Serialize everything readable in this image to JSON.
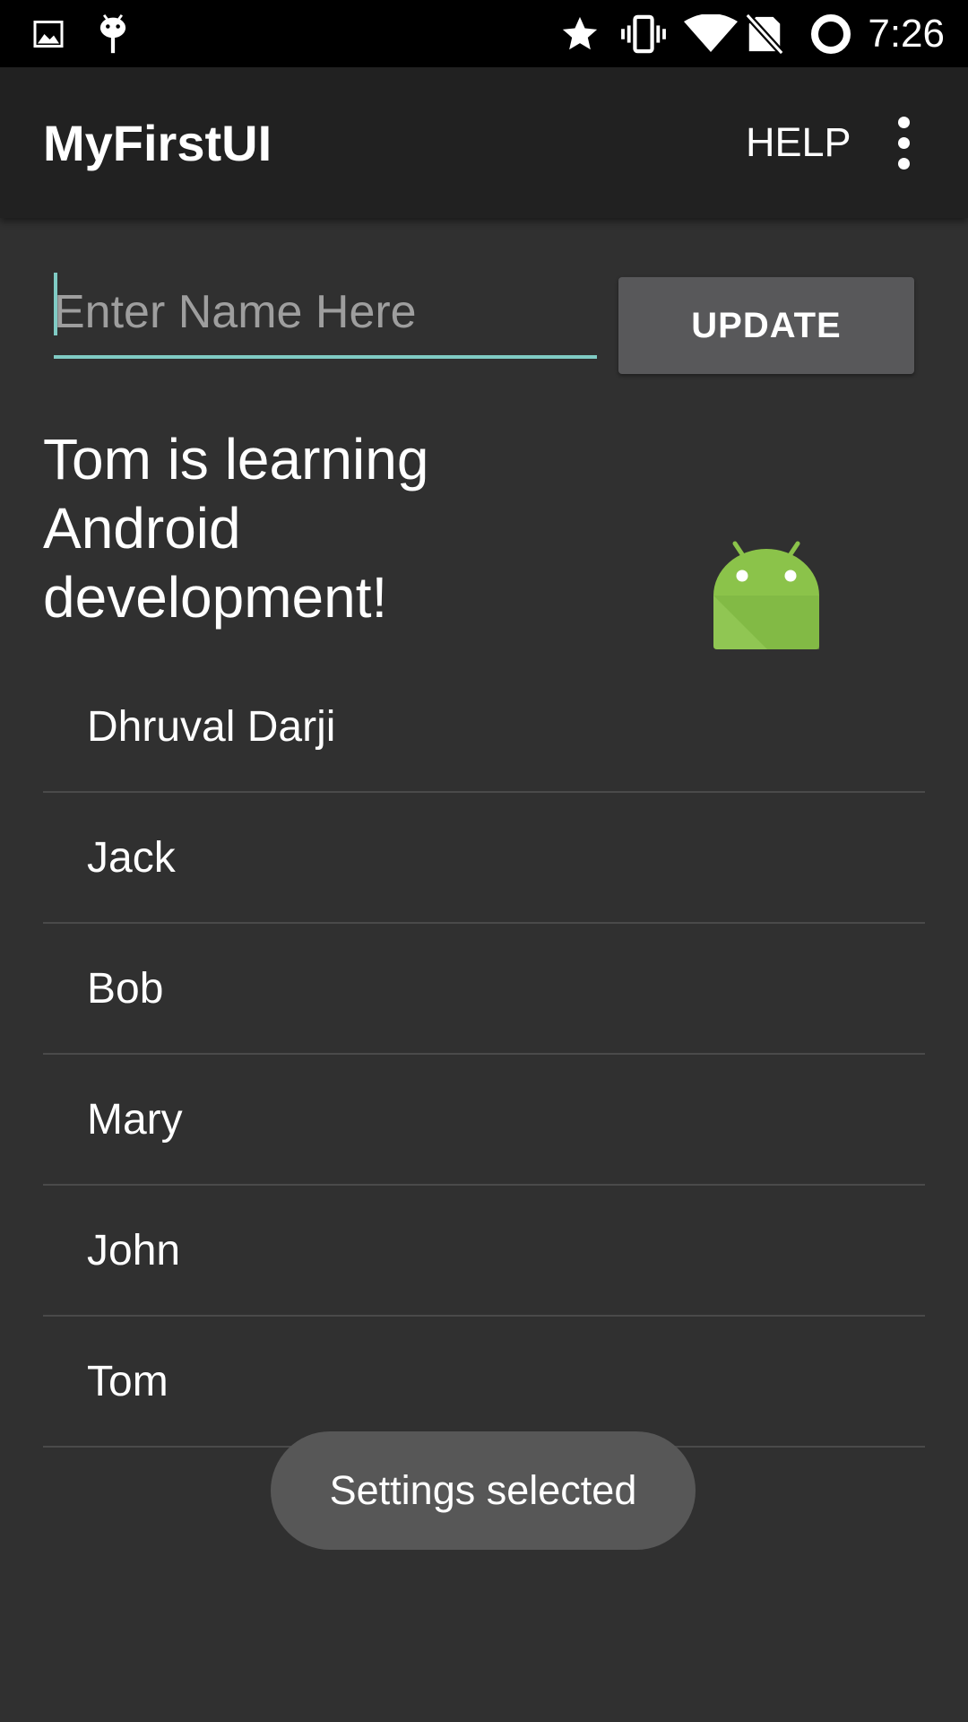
{
  "status_bar": {
    "time": "7:26",
    "left_icons": [
      "image-icon",
      "android-debug-icon"
    ],
    "right_icons": [
      "star-icon",
      "vibrate-icon",
      "wifi-icon",
      "no-sim-icon",
      "battery-ring-icon"
    ]
  },
  "app_bar": {
    "title": "MyFirstUI",
    "help_label": "HELP",
    "overflow_icon": "more-vertical-icon"
  },
  "form": {
    "name_placeholder": "Enter Name Here",
    "name_value": "",
    "update_label": "UPDATE"
  },
  "message": "Tom is learning Android development!",
  "names": [
    "Dhruval Darji",
    "Jack",
    "Bob",
    "Mary",
    "John",
    "Tom"
  ],
  "toast": "Settings selected",
  "colors": {
    "background": "#303030",
    "app_bar": "#212121",
    "accent": "#80cbc4",
    "button": "#58585a",
    "android_green": "#8bc34a"
  }
}
